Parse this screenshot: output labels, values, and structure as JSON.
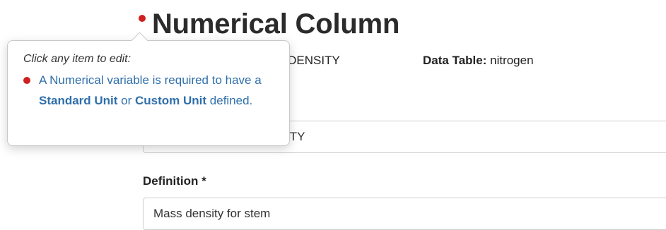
{
  "header": {
    "title": "Numerical Column"
  },
  "meta": {
    "variable_fragment": "SS_DENSITY",
    "data_table_label": "Data Table:",
    "data_table_value": "nitrogen"
  },
  "fields": {
    "name_visible_fragment": "ITY",
    "definition_label": "Definition *",
    "definition_value": "Mass density for stem"
  },
  "popover": {
    "title": "Click any item to edit:",
    "message_part1": "A Numerical variable is required to have a ",
    "standard_unit_link": "Standard Unit",
    "message_or": " or ",
    "custom_unit_link": "Custom Unit",
    "message_part2": " defined."
  },
  "colors": {
    "required": "#d0201f",
    "link": "#2f6faa"
  }
}
